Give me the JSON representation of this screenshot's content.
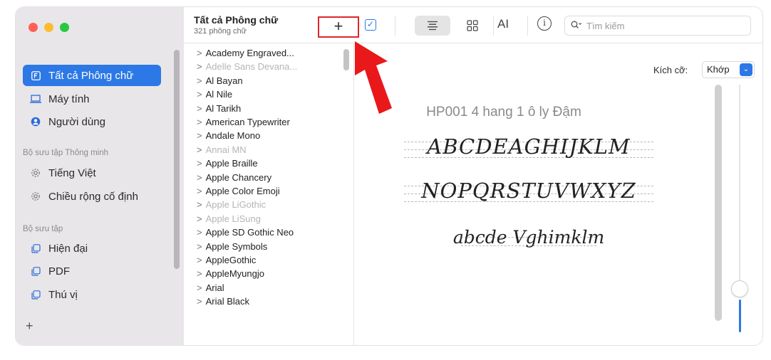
{
  "window": {
    "traffic_lights": [
      "#ff5f57",
      "#febc2e",
      "#28c840"
    ]
  },
  "sidebar": {
    "items": [
      {
        "label": "Tất cả Phông chữ",
        "icon": "font-box-icon",
        "active": true
      },
      {
        "label": "Máy tính",
        "icon": "laptop-icon"
      },
      {
        "label": "Người dùng",
        "icon": "user-icon"
      }
    ],
    "smart_section": "Bộ sưu tập Thông minh",
    "smart_items": [
      {
        "label": "Tiếng Việt",
        "icon": "gear-icon"
      },
      {
        "label": "Chiều rộng cố định",
        "icon": "gear-icon"
      }
    ],
    "collection_section": "Bộ sưu tập",
    "collection_items": [
      {
        "label": "Hiện đại",
        "icon": "collection-icon"
      },
      {
        "label": "PDF",
        "icon": "collection-icon"
      },
      {
        "label": "Thú vị",
        "icon": "collection-icon"
      }
    ],
    "add_label": "+"
  },
  "toolbar": {
    "title": "Tất cả Phông chữ",
    "subtitle": "321 phông chữ",
    "add_label": "+",
    "search_placeholder": "Tìm kiếm"
  },
  "font_list": [
    {
      "name": "Academy Engraved...",
      "dim": false
    },
    {
      "name": "Adelle Sans Devana...",
      "dim": true
    },
    {
      "name": "Al Bayan",
      "dim": false
    },
    {
      "name": "Al Nile",
      "dim": false
    },
    {
      "name": "Al Tarikh",
      "dim": false
    },
    {
      "name": "American Typewriter",
      "dim": false
    },
    {
      "name": "Andale Mono",
      "dim": false
    },
    {
      "name": "Annai MN",
      "dim": true
    },
    {
      "name": "Apple Braille",
      "dim": false
    },
    {
      "name": "Apple Chancery",
      "dim": false
    },
    {
      "name": "Apple Color Emoji",
      "dim": false
    },
    {
      "name": "Apple LiGothic",
      "dim": true
    },
    {
      "name": "Apple LiSung",
      "dim": true
    },
    {
      "name": "Apple SD Gothic Neo",
      "dim": false
    },
    {
      "name": "Apple Symbols",
      "dim": false
    },
    {
      "name": "AppleGothic",
      "dim": false
    },
    {
      "name": "AppleMyungjo",
      "dim": false
    },
    {
      "name": "Arial",
      "dim": false
    },
    {
      "name": "Arial Black",
      "dim": false
    }
  ],
  "preview": {
    "size_label": "Kích cỡ:",
    "size_value": "Khớp",
    "font_title": "HP001 4 hang 1 ô ly Đậm",
    "sample_line1": "ABCDEAGHIJKLM",
    "sample_line2": "NOPQRSTUVWXYZ",
    "sample_line3": "abcde Vghimklm"
  },
  "accent_color": "#2c78e6",
  "highlight_color": "#e0262b"
}
